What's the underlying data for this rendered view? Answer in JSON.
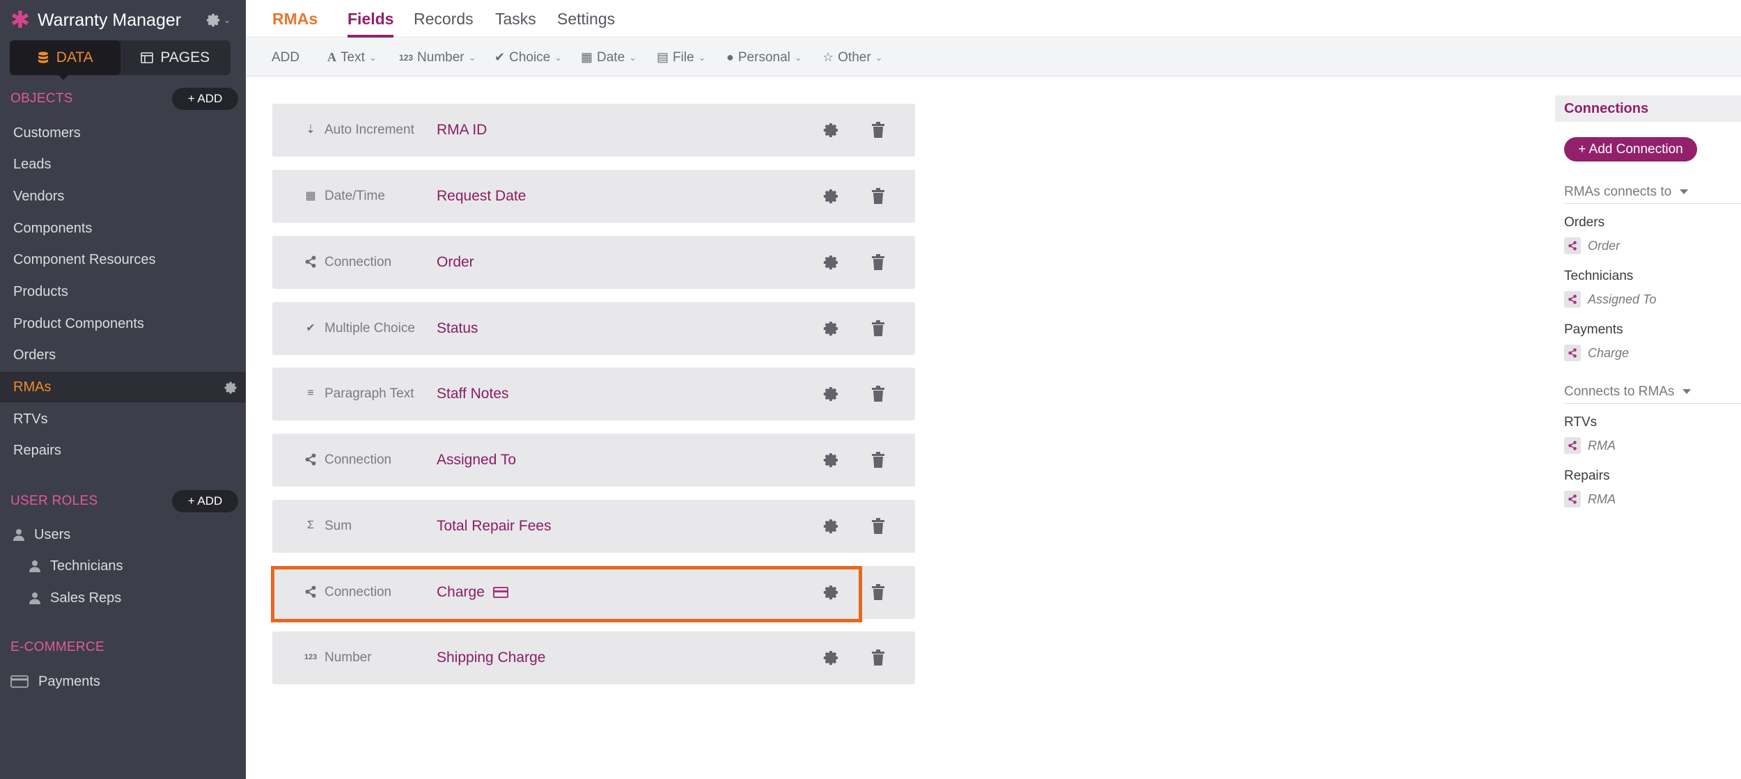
{
  "app": {
    "name": "Warranty Manager"
  },
  "toggle": {
    "data_label": "DATA",
    "pages_label": "PAGES"
  },
  "objects": {
    "heading": "OBJECTS",
    "add_label": "+ ADD",
    "items": [
      "Customers",
      "Leads",
      "Vendors",
      "Components",
      "Component Resources",
      "Products",
      "Product Components",
      "Orders",
      "RMAs",
      "RTVs",
      "Repairs"
    ],
    "active": "RMAs"
  },
  "user_roles": {
    "heading": "USER ROLES",
    "add_label": "+ ADD",
    "items": [
      "Users",
      "Technicians",
      "Sales Reps"
    ]
  },
  "ecommerce": {
    "heading": "E-COMMERCE",
    "items": [
      "Payments"
    ]
  },
  "tabs": {
    "object": "RMAs",
    "items": [
      "Fields",
      "Records",
      "Tasks",
      "Settings"
    ],
    "active": "Fields"
  },
  "add_toolbar": {
    "label": "ADD",
    "buttons": [
      {
        "label": "Text",
        "icon": "text-icon"
      },
      {
        "label": "Number",
        "icon": "number-icon"
      },
      {
        "label": "Choice",
        "icon": "choice-icon"
      },
      {
        "label": "Date",
        "icon": "calendar-icon"
      },
      {
        "label": "File",
        "icon": "file-icon"
      },
      {
        "label": "Personal",
        "icon": "person-icon"
      },
      {
        "label": "Other",
        "icon": "star-icon"
      }
    ]
  },
  "fields": [
    {
      "type": "Auto Increment",
      "name": "RMA ID",
      "icon": "auto-increment-icon"
    },
    {
      "type": "Date/Time",
      "name": "Request Date",
      "icon": "calendar-icon"
    },
    {
      "type": "Connection",
      "name": "Order",
      "icon": "connection-icon"
    },
    {
      "type": "Multiple Choice",
      "name": "Status",
      "icon": "choice-icon"
    },
    {
      "type": "Paragraph Text",
      "name": "Staff Notes",
      "icon": "paragraph-icon"
    },
    {
      "type": "Connection",
      "name": "Assigned To",
      "icon": "connection-icon"
    },
    {
      "type": "Sum",
      "name": "Total Repair Fees",
      "icon": "sum-icon"
    },
    {
      "type": "Connection",
      "name": "Charge",
      "icon": "connection-icon",
      "badge": "credit-card-icon",
      "highlighted": true
    },
    {
      "type": "Number",
      "name": "Shipping Charge",
      "icon": "number-icon"
    }
  ],
  "connections": {
    "heading": "Connections",
    "add_label": "+ Add Connection",
    "outgoing_label": "RMAs connects to",
    "outgoing": [
      {
        "object": "Orders",
        "field": "Order"
      },
      {
        "object": "Technicians",
        "field": "Assigned To"
      },
      {
        "object": "Payments",
        "field": "Charge"
      }
    ],
    "incoming_label": "Connects to RMAs",
    "incoming": [
      {
        "object": "RTVs",
        "field": "RMA"
      },
      {
        "object": "Repairs",
        "field": "RMA"
      }
    ]
  },
  "colors": {
    "accent": "#92206a",
    "orange": "#e8762c",
    "sidebar": "#3c3e49",
    "highlight": "#e8681f"
  }
}
